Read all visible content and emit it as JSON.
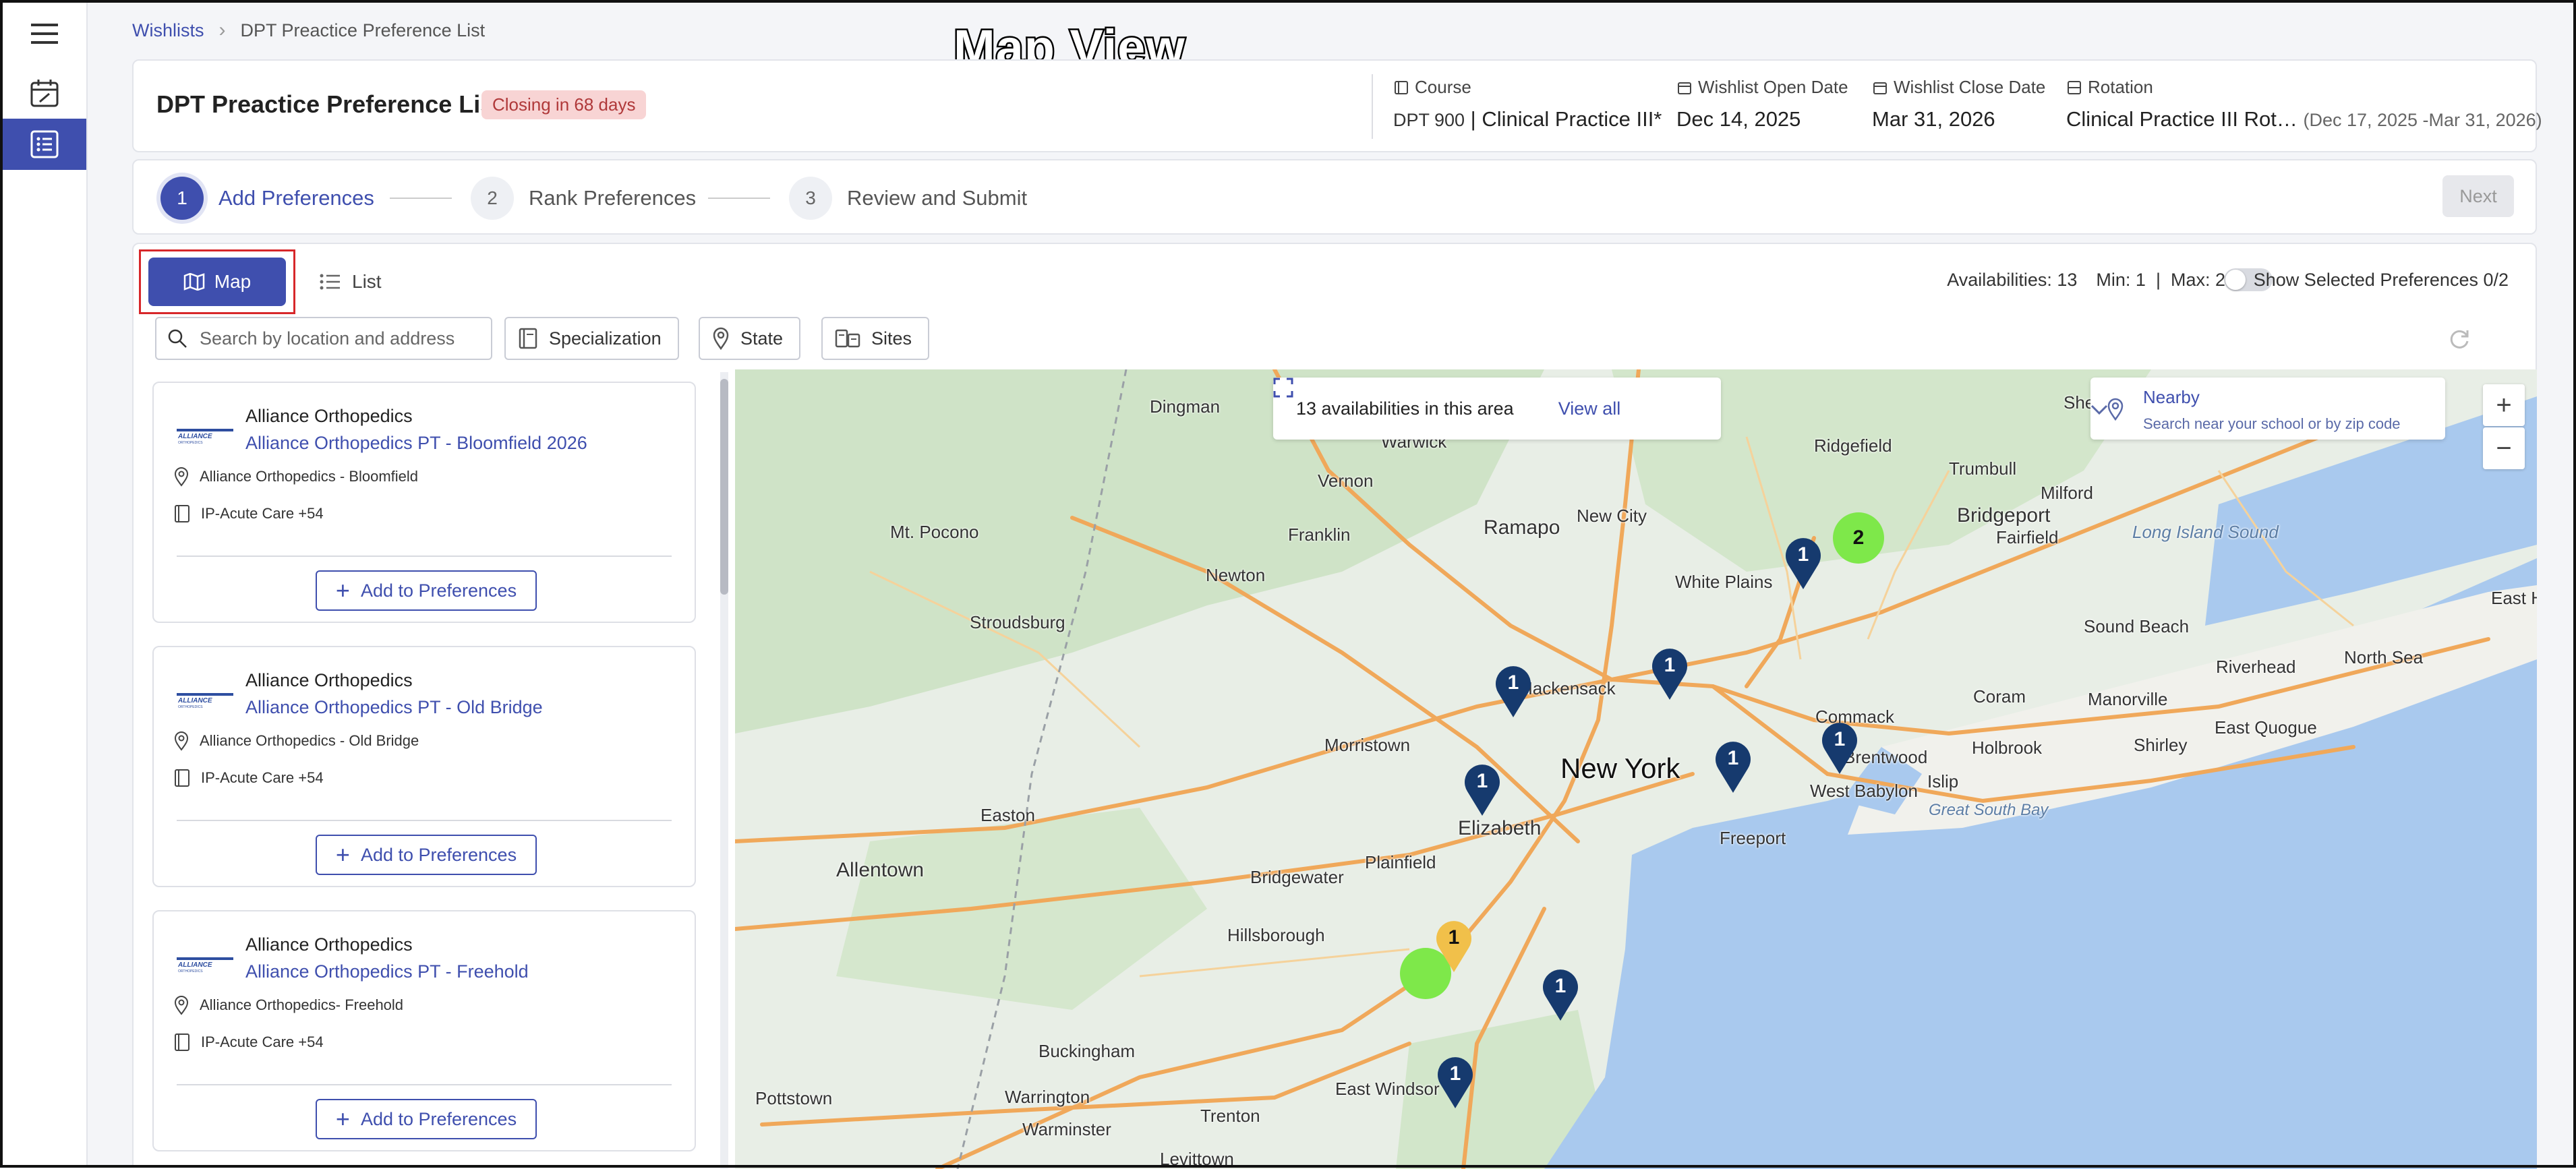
{
  "overlay_title": "Map View",
  "breadcrumb": {
    "root": "Wishlists",
    "current": "DPT Preactice Preference List"
  },
  "header": {
    "title": "DPT Preactice Preference List",
    "badge": "Closing in 68 days",
    "course_label": "Course",
    "course_code": "DPT 900",
    "course_name": "Clinical Practice III*",
    "open_label": "Wishlist Open Date",
    "open_value": "Dec 14, 2025",
    "close_label": "Wishlist Close Date",
    "close_value": "Mar 31, 2026",
    "rotation_label": "Rotation",
    "rotation_name": "Clinical Practice III Rot…",
    "rotation_dates": "(Dec 17, 2025 -Mar 31, 2026)"
  },
  "stepper": {
    "steps": [
      {
        "num": "1",
        "label": "Add Preferences"
      },
      {
        "num": "2",
        "label": "Rank Preferences"
      },
      {
        "num": "3",
        "label": "Review and Submit"
      }
    ],
    "next": "Next"
  },
  "toolbar": {
    "map": "Map",
    "list": "List",
    "availabilities": "Availabilities: 13",
    "min": "Min: 1",
    "sep": "|",
    "max": "Max: 2",
    "show_selected": "Show Selected Preferences 0/2",
    "search_placeholder": "Search by location and address",
    "filters": [
      "Specialization",
      "State",
      "Sites"
    ]
  },
  "list": [
    {
      "org": "Alliance Orthopedics",
      "site": "Alliance Orthopedics PT - Bloomfield 2026",
      "location": "Alliance Orthopedics - Bloomfield",
      "specialty": "IP-Acute Care +54",
      "add": "Add to Preferences"
    },
    {
      "org": "Alliance Orthopedics",
      "site": "Alliance Orthopedics PT - Old Bridge",
      "location": "Alliance Orthopedics - Old Bridge",
      "specialty": "IP-Acute Care +54",
      "add": "Add to Preferences"
    },
    {
      "org": "Alliance Orthopedics",
      "site": "Alliance Orthopedics PT - Freehold",
      "location": "Alliance Orthopedics- Freehold",
      "specialty": "IP-Acute Care +54",
      "add": "Add to Preferences"
    }
  ],
  "logo_text": "ALLIANCE ORTHOPEDICS",
  "map": {
    "availability_text": "13 availabilities in this area",
    "view_all": "View all",
    "nearby_title": "Nearby",
    "nearby_sub": "Search near your school or by zip code",
    "zoom_in": "+",
    "zoom_out": "−",
    "places": [
      "Dingman",
      "Warwick",
      "Shelton",
      "Ridgefield",
      "Trumbull",
      "Milford",
      "Bridgeport",
      "Fairfield",
      "Mt. Pocono",
      "Vernon",
      "Franklin",
      "Ramapo",
      "New City",
      "White Plains",
      "Long Island Sound",
      "Newton",
      "Stroudsburg",
      "Hackensack",
      "Sound Beach",
      "Riverhead",
      "North Sea",
      "East Hamp",
      "Morristown",
      "New York",
      "Commack",
      "Coram",
      "Manorville",
      "East Quogue",
      "Easton",
      "Elizabeth",
      "Brentwood",
      "Holbrook",
      "Shirley",
      "West Babylon",
      "Islip",
      "Great South Bay",
      "Freeport",
      "Allentown",
      "Bridgewater",
      "Plainfield",
      "Hillsborough",
      "Buckingham",
      "Warrington",
      "East Windsor",
      "Pottstown",
      "Warminster",
      "Trenton",
      "Levittown"
    ],
    "markers": [
      "2",
      "1",
      "1",
      "1",
      "1",
      "1",
      "1",
      "1",
      "1",
      "1"
    ]
  },
  "colors": {
    "accent": "#3f4fae",
    "badge_bg": "#f8d4d4",
    "pin": "#163a6e",
    "cluster_green": "#7ee84a",
    "cluster_yellow": "#f1c04a"
  }
}
